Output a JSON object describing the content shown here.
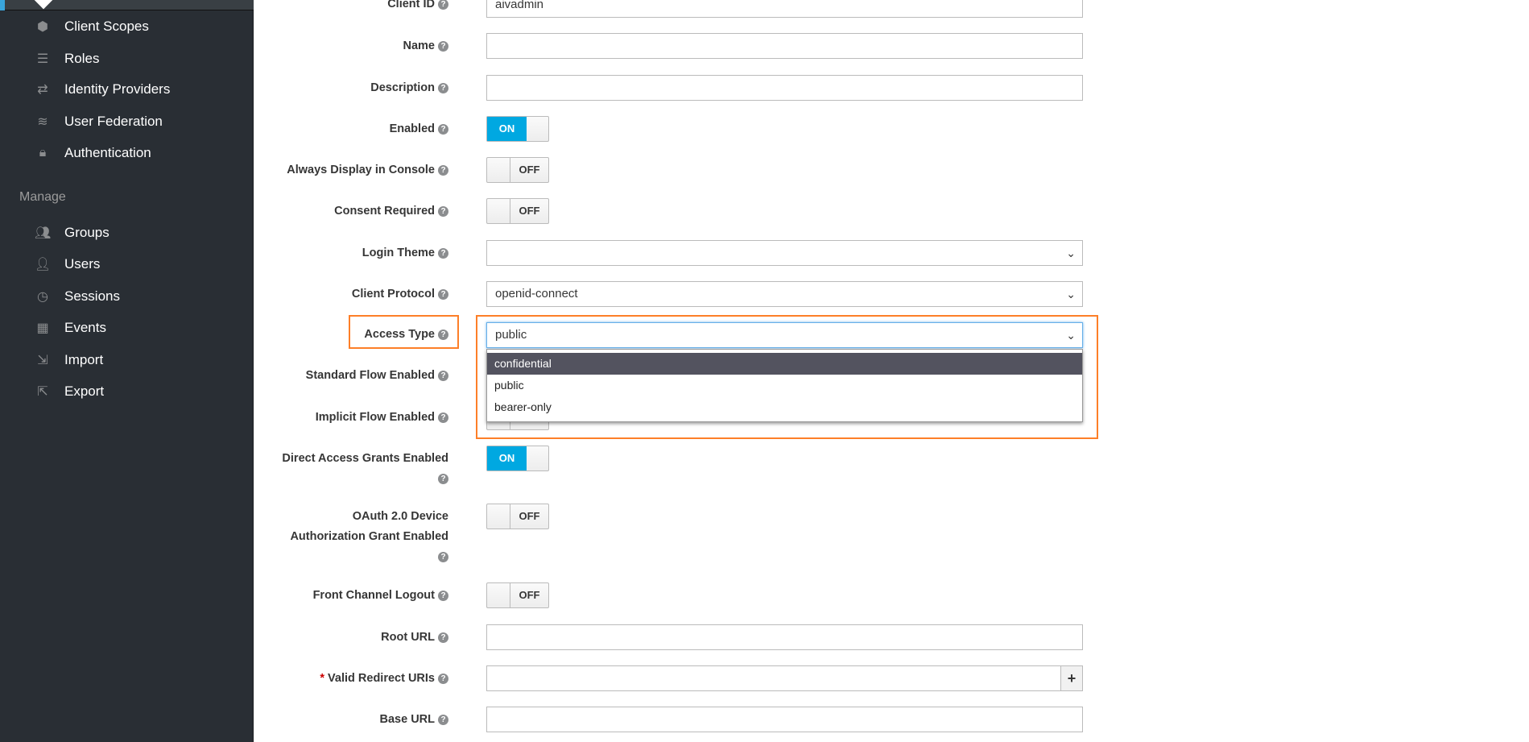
{
  "sidebar": {
    "items": [
      {
        "label": "Client Scopes",
        "icon": "cubes-icon"
      },
      {
        "label": "Roles",
        "icon": "roles-icon"
      },
      {
        "label": "Identity Providers",
        "icon": "exchange-icon"
      },
      {
        "label": "User Federation",
        "icon": "database-icon"
      },
      {
        "label": "Authentication",
        "icon": "lock-icon"
      }
    ],
    "manage_heading": "Manage",
    "manage_items": [
      {
        "label": "Groups",
        "icon": "users-group-icon"
      },
      {
        "label": "Users",
        "icon": "user-icon"
      },
      {
        "label": "Sessions",
        "icon": "clock-icon"
      },
      {
        "label": "Events",
        "icon": "calendar-icon"
      },
      {
        "label": "Import",
        "icon": "import-icon"
      },
      {
        "label": "Export",
        "icon": "export-icon"
      }
    ]
  },
  "form": {
    "client_id": {
      "label": "Client ID",
      "value": "aivadmin"
    },
    "name": {
      "label": "Name",
      "value": ""
    },
    "description": {
      "label": "Description",
      "value": ""
    },
    "enabled": {
      "label": "Enabled",
      "state": "ON"
    },
    "always_display": {
      "label": "Always Display in Console",
      "state": "OFF"
    },
    "consent_required": {
      "label": "Consent Required",
      "state": "OFF"
    },
    "login_theme": {
      "label": "Login Theme",
      "value": ""
    },
    "client_protocol": {
      "label": "Client Protocol",
      "value": "openid-connect"
    },
    "access_type": {
      "label": "Access Type",
      "value": "public",
      "options": [
        "confidential",
        "public",
        "bearer-only"
      ],
      "highlighted": "confidential"
    },
    "standard_flow": {
      "label": "Standard Flow Enabled"
    },
    "implicit_flow": {
      "label": "Implicit Flow Enabled"
    },
    "direct_access": {
      "label": "Direct Access Grants Enabled",
      "state": "ON"
    },
    "oauth_device": {
      "label": "OAuth 2.0 Device Authorization Grant Enabled",
      "state": "OFF"
    },
    "front_channel": {
      "label": "Front Channel Logout",
      "state": "OFF"
    },
    "root_url": {
      "label": "Root URL",
      "value": ""
    },
    "valid_redirect": {
      "label": "Valid Redirect URIs",
      "required_mark": "*",
      "value": "",
      "add": "+"
    },
    "base_url": {
      "label": "Base URL",
      "value": ""
    }
  },
  "help_glyph": "?",
  "colors": {
    "accent": "#00a8e1",
    "highlight": "#fd7f28",
    "sidebar": "#292e34"
  }
}
